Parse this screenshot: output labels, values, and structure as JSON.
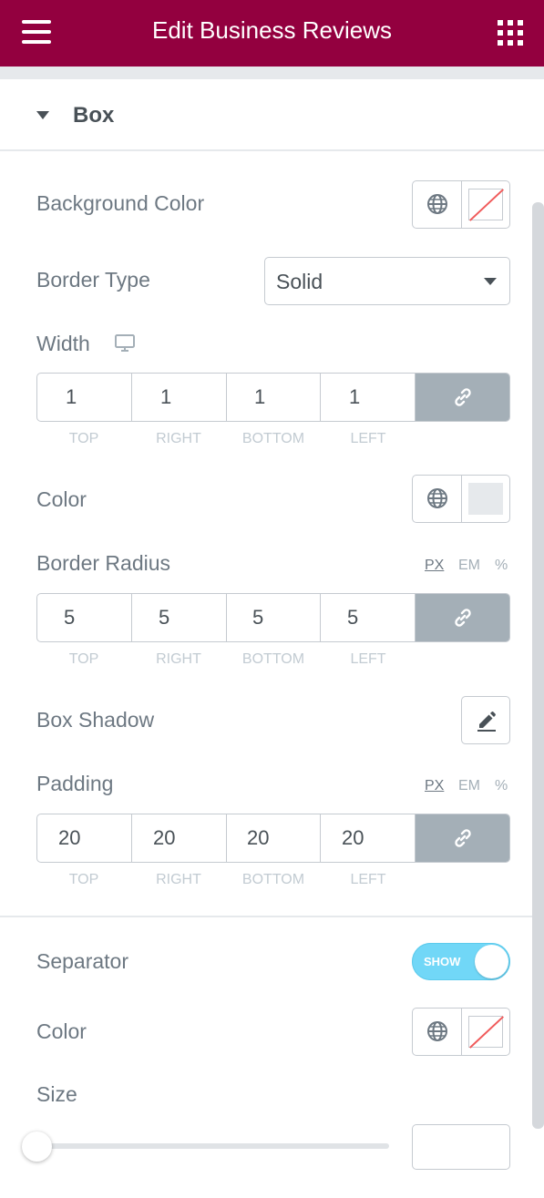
{
  "header": {
    "title": "Edit Business Reviews"
  },
  "section": {
    "label": "Box"
  },
  "background_color": {
    "label": "Background Color"
  },
  "border_type": {
    "label": "Border Type",
    "value": "Solid"
  },
  "width": {
    "label": "Width",
    "values": [
      "1",
      "1",
      "1",
      "1"
    ],
    "sides": [
      "TOP",
      "RIGHT",
      "BOTTOM",
      "LEFT"
    ]
  },
  "border_color": {
    "label": "Color"
  },
  "border_radius": {
    "label": "Border Radius",
    "units": [
      "PX",
      "EM",
      "%"
    ],
    "active_unit": "PX",
    "values": [
      "5",
      "5",
      "5",
      "5"
    ],
    "sides": [
      "TOP",
      "RIGHT",
      "BOTTOM",
      "LEFT"
    ]
  },
  "box_shadow": {
    "label": "Box Shadow"
  },
  "padding": {
    "label": "Padding",
    "units": [
      "PX",
      "EM",
      "%"
    ],
    "active_unit": "PX",
    "values": [
      "20",
      "20",
      "20",
      "20"
    ],
    "sides": [
      "TOP",
      "RIGHT",
      "BOTTOM",
      "LEFT"
    ]
  },
  "separator": {
    "label": "Separator",
    "toggle_text": "SHOW",
    "enabled": true
  },
  "separator_color": {
    "label": "Color"
  },
  "size": {
    "label": "Size",
    "value": ""
  },
  "colors": {
    "header": "#93003f",
    "toggle": "#71d7f7",
    "link_button": "#a4afb7"
  }
}
